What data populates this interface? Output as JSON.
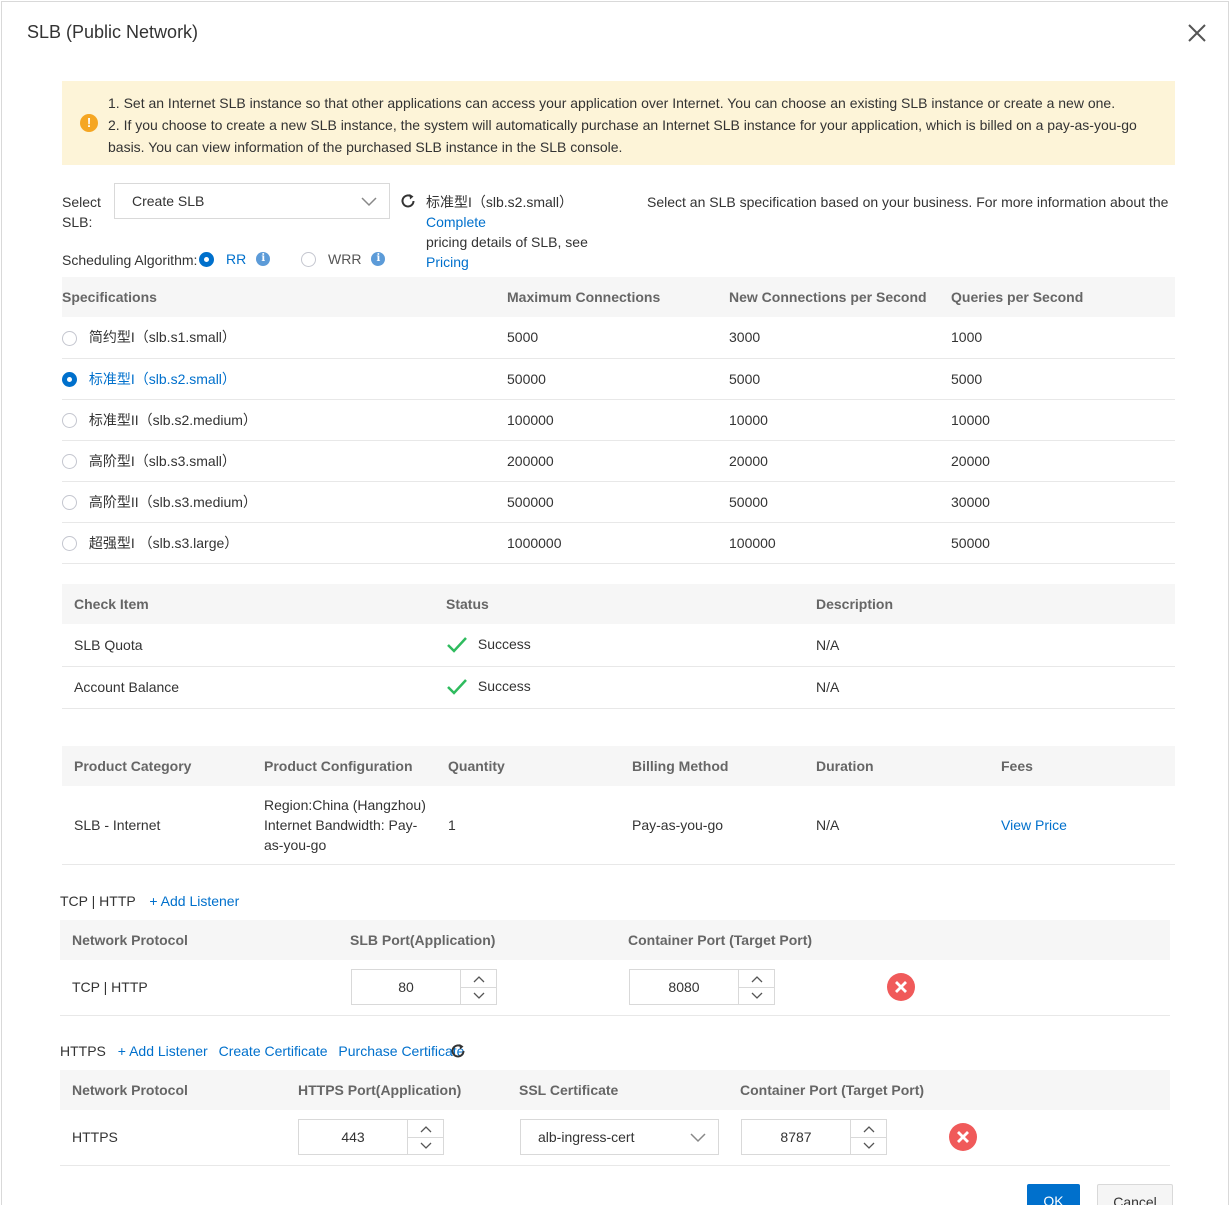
{
  "dialog": {
    "title": "SLB (Public Network)"
  },
  "notice": {
    "line1": "1. Set an Internet SLB instance so that other applications can access your application over Internet. You can choose an existing SLB instance or create a new one.",
    "line2": "2. If you choose to create a new SLB instance, the system will automatically purchase an Internet SLB instance for your application, which is billed on a pay-as-you-go basis. You can view information of the purchased SLB instance in the SLB console."
  },
  "select_slb": {
    "label_line1": "Select",
    "label_line2": "SLB:",
    "value": "Create SLB",
    "selected_spec": "标准型I（slb.s2.small）",
    "complete_link": "Complete",
    "pricing_prefix": "pricing details of SLB, see",
    "pricing_link": "Pricing",
    "hint": "Select an SLB specification based on your business. For more information about the"
  },
  "scheduling": {
    "label": "Scheduling Algorithm:",
    "options": [
      {
        "label": "RR",
        "selected": true
      },
      {
        "label": "WRR",
        "selected": false
      }
    ]
  },
  "spec_table": {
    "headers": [
      "Specifications",
      "Maximum Connections",
      "New Connections per Second",
      "Queries per Second"
    ],
    "rows": [
      {
        "name": "简约型I（slb.s1.small）",
        "max": "5000",
        "new": "3000",
        "qps": "1000",
        "selected": false
      },
      {
        "name": "标准型I（slb.s2.small）",
        "max": "50000",
        "new": "5000",
        "qps": "5000",
        "selected": true
      },
      {
        "name": "标准型II（slb.s2.medium）",
        "max": "100000",
        "new": "10000",
        "qps": "10000",
        "selected": false
      },
      {
        "name": "高阶型I（slb.s3.small）",
        "max": "200000",
        "new": "20000",
        "qps": "20000",
        "selected": false
      },
      {
        "name": "高阶型II（slb.s3.medium）",
        "max": "500000",
        "new": "50000",
        "qps": "30000",
        "selected": false
      },
      {
        "name": "超强型I （slb.s3.large）",
        "max": "1000000",
        "new": "100000",
        "qps": "50000",
        "selected": false
      }
    ]
  },
  "check_table": {
    "headers": [
      "Check Item",
      "Status",
      "Description"
    ],
    "rows": [
      {
        "item": "SLB Quota",
        "status": "Success",
        "desc": "N/A"
      },
      {
        "item": "Account Balance",
        "status": "Success",
        "desc": "N/A"
      }
    ]
  },
  "billing_table": {
    "headers": [
      "Product Category",
      "Product Configuration",
      "Quantity",
      "Billing Method",
      "Duration",
      "Fees"
    ],
    "row": {
      "category": "SLB - Internet",
      "config_line1": "Region:China (Hangzhou)",
      "config_line2": "Internet Bandwidth: Pay-",
      "config_line3": "as-you-go",
      "quantity": "1",
      "billing": "Pay-as-you-go",
      "duration": "N/A",
      "fees_link": "View Price"
    }
  },
  "tcp_section": {
    "label": "TCP | HTTP",
    "add_listener": "+ Add Listener",
    "headers": [
      "Network Protocol",
      "SLB Port(Application)",
      "Container Port (Target Port)"
    ],
    "row": {
      "protocol": "TCP | HTTP",
      "slb_port": "80",
      "container_port": "8080"
    }
  },
  "https_section": {
    "label": "HTTPS",
    "add_listener": "+ Add Listener",
    "create_cert": "Create Certificate",
    "purchase_cert": "Purchase Certificate",
    "headers": [
      "Network Protocol",
      "HTTPS Port(Application)",
      "SSL Certificate",
      "Container Port (Target Port)"
    ],
    "row": {
      "protocol": "HTTPS",
      "https_port": "443",
      "certificate": "alb-ingress-cert",
      "container_port": "8787"
    }
  },
  "footer": {
    "ok": "OK",
    "cancel": "Cancel"
  },
  "colors": {
    "primary": "#0070cc",
    "notice_bg": "#fdf4d8",
    "warning": "#f5a623",
    "success": "#2fbb5e",
    "danger": "#f05a5a"
  }
}
